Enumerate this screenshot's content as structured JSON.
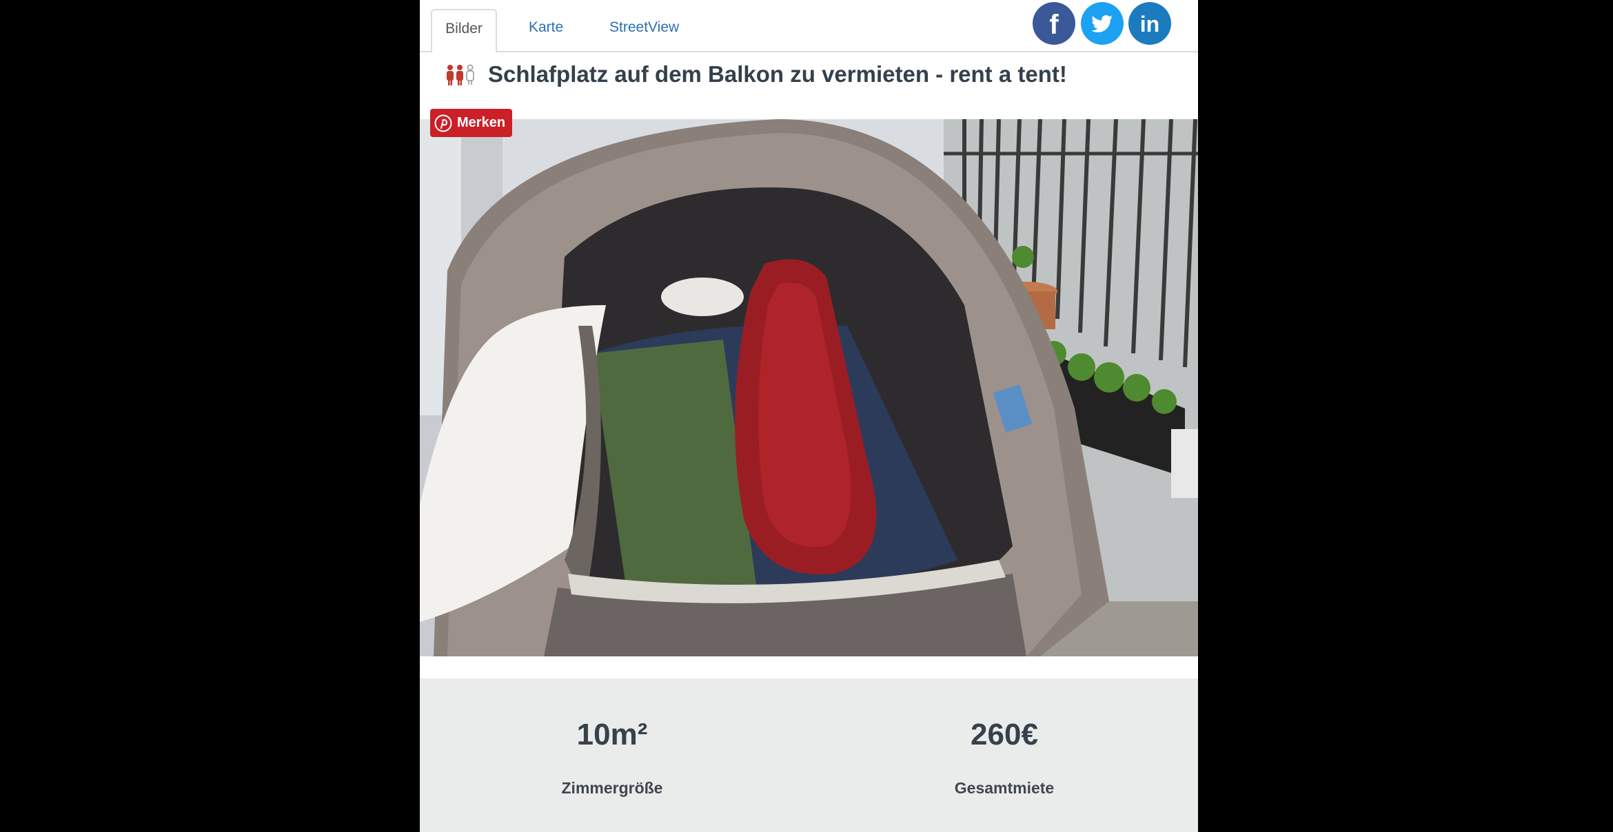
{
  "tabs": [
    {
      "label": "Bilder",
      "active": true
    },
    {
      "label": "Karte",
      "active": false
    },
    {
      "label": "StreetView",
      "active": false
    }
  ],
  "social": [
    {
      "icon": "facebook-icon",
      "glyph": "f",
      "color": "#3b5998"
    },
    {
      "icon": "twitter-icon",
      "color": "#1da1f2"
    },
    {
      "icon": "linkedin-icon",
      "glyph": "in",
      "color": "#1c7bbf"
    }
  ],
  "listing": {
    "title_icon": "people-icon",
    "title": "Schlafplatz auf dem Balkon zu vermieten - rent a tent!"
  },
  "photo": {
    "pin_button_label": "Merken",
    "pin_icon": "pinterest-icon"
  },
  "stats": [
    {
      "value": "10m²",
      "label": "Zimmergröße"
    },
    {
      "value": "260€",
      "label": "Gesamtmiete"
    }
  ],
  "colors": {
    "link": "#2a6fb4",
    "title": "#34404c",
    "pin_red": "#cb2027",
    "stats_bg": "#eaebeb"
  }
}
